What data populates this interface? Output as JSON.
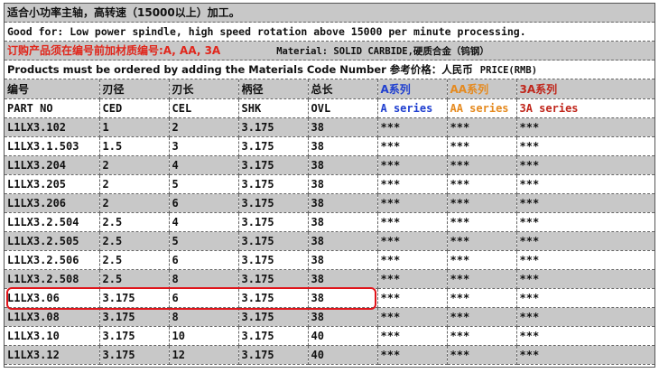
{
  "lines": {
    "line1": "适合小功率主轴，高转速（15000以上）加工。",
    "line2": "Good for: Low power spindle, high speed rotation above 15000 per minute processing.",
    "line3_red": "订购产品须在编号前加材质编号:A, AA, 3A",
    "line3_material": "Material:  SOLID CARBIDE,硬质合金（钨钢）",
    "line4": "Products must be ordered by adding the Materials Code Number 参考价格：人民币",
    "line4_price": "PRICE(RMB)"
  },
  "headers_cn": [
    "编号",
    "刃径",
    "刃长",
    "柄径",
    "总长",
    "A系列",
    "AA系列",
    "3A系列"
  ],
  "headers_en": [
    "PART NO",
    "CED",
    "CEL",
    "SHK",
    "OVL",
    "A series",
    "AA series",
    "3A series"
  ],
  "rows": [
    [
      "L1LX3.102",
      "1",
      "2",
      "3.175",
      "38",
      "***",
      "***",
      "***"
    ],
    [
      "L1LX3.1.503",
      "1.5",
      "3",
      "3.175",
      "38",
      "***",
      "***",
      "***"
    ],
    [
      "L1LX3.204",
      "2",
      "4",
      "3.175",
      "38",
      "***",
      "***",
      "***"
    ],
    [
      "L1LX3.205",
      "2",
      "5",
      "3.175",
      "38",
      "***",
      "***",
      "***"
    ],
    [
      "L1LX3.206",
      "2",
      "6",
      "3.175",
      "38",
      "***",
      "***",
      "***"
    ],
    [
      "L1LX3.2.504",
      "2.5",
      "4",
      "3.175",
      "38",
      "***",
      "***",
      "***"
    ],
    [
      "L1LX3.2.505",
      "2.5",
      "5",
      "3.175",
      "38",
      "***",
      "***",
      "***"
    ],
    [
      "L1LX3.2.506",
      "2.5",
      "6",
      "3.175",
      "38",
      "***",
      "***",
      "***"
    ],
    [
      "L1LX3.2.508",
      "2.5",
      "8",
      "3.175",
      "38",
      "***",
      "***",
      "***"
    ],
    [
      "L1LX3.06",
      "3.175",
      "6",
      "3.175",
      "38",
      "***",
      "***",
      "***"
    ],
    [
      "L1LX3.08",
      "3.175",
      "8",
      "3.175",
      "38",
      "***",
      "***",
      "***"
    ],
    [
      "L1LX3.10",
      "3.175",
      "10",
      "3.175",
      "40",
      "***",
      "***",
      "***"
    ],
    [
      "L1LX3.12",
      "3.175",
      "12",
      "3.175",
      "40",
      "***",
      "***",
      "***"
    ]
  ],
  "highlighted_row": 9,
  "colors": {
    "red_text": "#e0261b",
    "a_series": "#1f3fd0",
    "aa_series": "#e58a1f",
    "3a_series": "#c0261b",
    "highlight_box": "#e0141a",
    "row_gray": "#c8c8c8"
  }
}
